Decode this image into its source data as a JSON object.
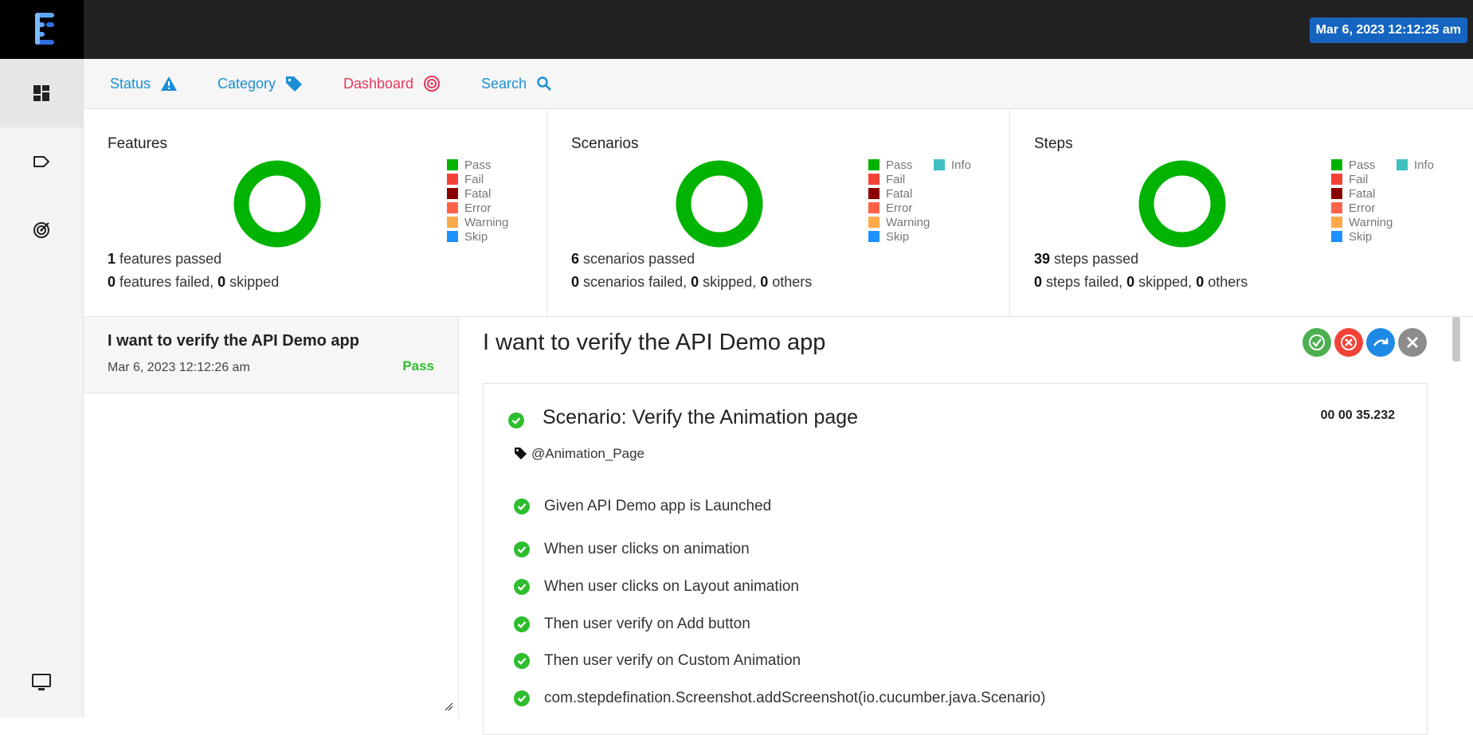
{
  "header": {
    "datetime": "Mar 6, 2023 12:12:25 am"
  },
  "sidebar": {
    "items": [
      {
        "icon": "dashboard-icon",
        "active": true
      },
      {
        "icon": "tag-icon",
        "active": false
      },
      {
        "icon": "target-icon",
        "active": false
      },
      {
        "icon": "monitor-icon",
        "active": false
      }
    ]
  },
  "nav": {
    "status": "Status",
    "category": "Category",
    "dashboard": "Dashboard",
    "search": "Search"
  },
  "colors": {
    "pass": "#00b300",
    "fail": "#f44336",
    "fatal": "#8b0000",
    "error": "#ff6347",
    "warning": "#ffa94d",
    "skip": "#1e90ff",
    "info": "#40c0c0",
    "link": "#1a8fd6",
    "dashboard": "#e8365d"
  },
  "legend": {
    "pass": "Pass",
    "fail": "Fail",
    "fatal": "Fatal",
    "error": "Error",
    "warning": "Warning",
    "skip": "Skip",
    "info": "Info"
  },
  "cards": {
    "features": {
      "title": "Features",
      "passed_count": "1",
      "passed_text": "features passed",
      "failed_count": "0",
      "failed_text": "features failed,",
      "skipped_count": "0",
      "skipped_text": "skipped"
    },
    "scenarios": {
      "title": "Scenarios",
      "passed_count": "6",
      "passed_text": "scenarios passed",
      "failed_count": "0",
      "failed_text": "scenarios failed,",
      "skipped_count": "0",
      "skipped_text": "skipped,",
      "others_count": "0",
      "others_text": "others"
    },
    "steps": {
      "title": "Steps",
      "passed_count": "39",
      "passed_text": "steps passed",
      "failed_count": "0",
      "failed_text": "steps failed,",
      "skipped_count": "0",
      "skipped_text": "skipped,",
      "others_count": "0",
      "others_text": "others"
    }
  },
  "test_list": {
    "items": [
      {
        "name": "I want to verify the API Demo app",
        "time": "Mar 6, 2023 12:12:26 am",
        "status": "Pass"
      }
    ]
  },
  "detail": {
    "title": "I want to verify the API Demo app",
    "scenario": {
      "title": "Scenario: Verify the Animation page",
      "duration": "00 00 35.232",
      "tag": "@Animation_Page"
    },
    "steps": [
      "Given API Demo app is Launched",
      "When user clicks on animation",
      "When user clicks on Layout animation",
      "Then user verify on Add button",
      "Then user verify on Custom Animation",
      "com.stepdefination.Screenshot.addScreenshot(io.cucumber.java.Scenario)"
    ]
  }
}
